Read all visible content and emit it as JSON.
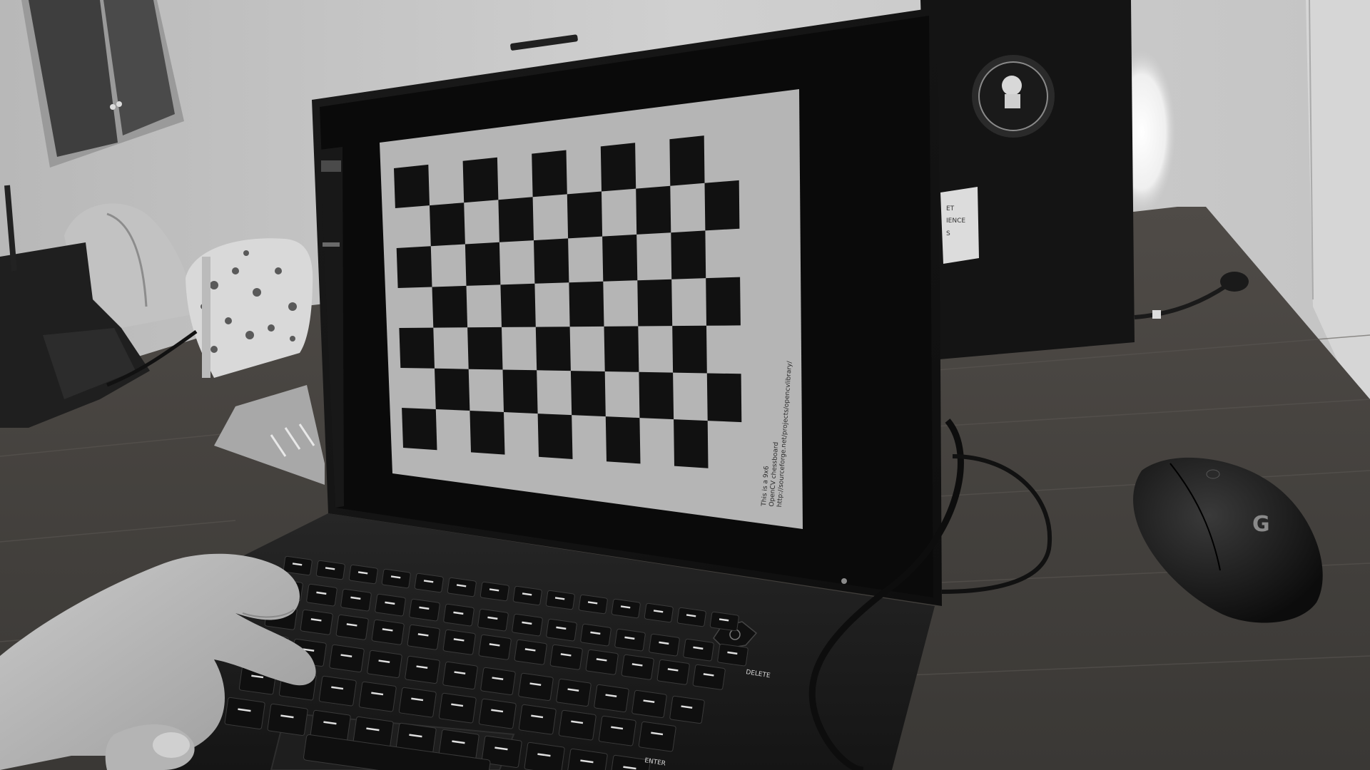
{
  "scene": {
    "monochrome": true,
    "subject": "laptop-showing-checkerboard",
    "checkerboard": {
      "rows": 7,
      "cols": 10
    }
  },
  "screen_caption": {
    "line1": "This is a 9x6",
    "line2": "OpenCV chessboard",
    "line3": "http://sourceforge.net/projects/opencvlibrary/"
  },
  "keyboard": {
    "enter_label": "ENTER",
    "delete_label": "DELETE"
  },
  "mouse": {
    "logo": "G"
  },
  "colors": {
    "wall": "#c9c9c9",
    "desk": "#4a4744",
    "laptop": "#1c1c1c",
    "screen_paper": "#bdbdbd",
    "square_dark": "#111111"
  }
}
